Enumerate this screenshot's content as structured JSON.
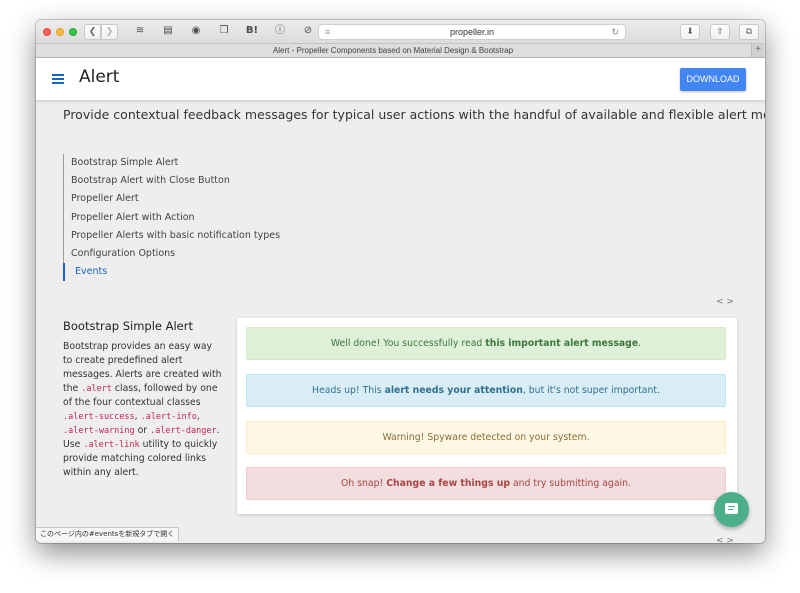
{
  "browser": {
    "url": "propeller.in",
    "tab_title": "Alert - Propeller Components based on Material Design & Bootstrap",
    "toolbar_icons": [
      "layers-icon",
      "sidebar-icon",
      "record-icon",
      "copy-icon",
      "hatena-bookmark-icon",
      "info-icon",
      "block-icon"
    ],
    "hatena_label": "B!",
    "status_text": "このページ内の#eventsを新規タブで開く"
  },
  "app": {
    "title": "Alert",
    "download_label": "DOWNLOAD",
    "accent_color": "#4285f4"
  },
  "lead": "Provide contextual feedback messages for typical user actions with the handful of available and flexible alert messages.",
  "toc": [
    {
      "label": "Bootstrap Simple Alert",
      "active": false
    },
    {
      "label": "Bootstrap Alert with Close Button",
      "active": false
    },
    {
      "label": "Propeller Alert",
      "active": false
    },
    {
      "label": "Propeller Alert with Action",
      "active": false
    },
    {
      "label": "Propeller Alerts with basic notification types",
      "active": false
    },
    {
      "label": "Configuration Options",
      "active": false
    },
    {
      "label": "Events",
      "active": true
    }
  ],
  "code_toggle": "< >",
  "section": {
    "title": "Bootstrap Simple Alert",
    "desc_1": "Bootstrap provides an easy way to create predefined alert messages. Alerts are created with the ",
    "code_1": ".alert",
    "desc_2": " class, followed by one of the four contextual classes ",
    "code_2": ".alert-success",
    "desc_3": ", ",
    "code_3": ".alert-info",
    "desc_4": ", ",
    "code_4": ".alert-warning",
    "desc_5": " or ",
    "code_5": ".alert-danger",
    "desc_6": ". Use ",
    "code_6": ".alert-link",
    "desc_7": " utility to quickly provide matching colored links within any alert."
  },
  "alerts": {
    "success": {
      "prefix": "Well done! You successfully read ",
      "bold": "this important alert message",
      "suffix": "."
    },
    "info": {
      "prefix": "Heads up! This ",
      "bold": "alert needs your attention",
      "suffix": ", but it's not super important."
    },
    "warning": {
      "text": "Warning! Spyware detected on your system."
    },
    "danger": {
      "prefix": "Oh snap! ",
      "bold": "Change a few things up",
      "suffix": " and try submitting again."
    }
  }
}
